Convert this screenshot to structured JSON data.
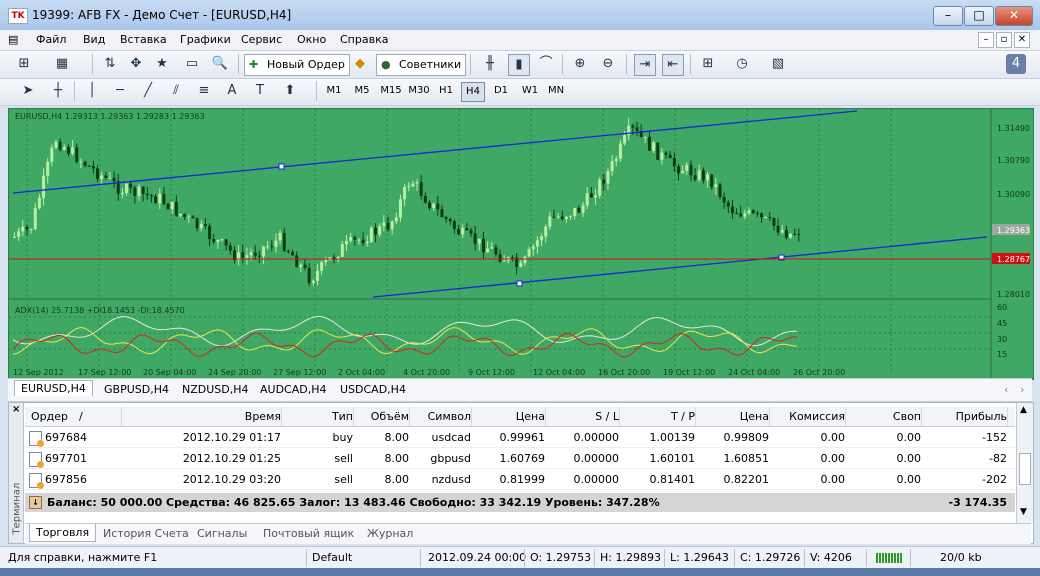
{
  "window": {
    "title": "19399: AFB FX - Демо Счет - [EURUSD,H4]",
    "app_icon_text": "TK",
    "controls": [
      "–",
      "□",
      "✕"
    ]
  },
  "menu": [
    "Файл",
    "Вид",
    "Вставка",
    "Графики",
    "Сервис",
    "Окно",
    "Справка"
  ],
  "toolbar": {
    "new_order_label": "Новый Ордер",
    "advisors_label": "Советники",
    "timeframes": [
      "M1",
      "M5",
      "M15",
      "M30",
      "H1",
      "H4",
      "D1",
      "W1",
      "MN"
    ],
    "active_timeframe": "H4",
    "alert_badge": "4"
  },
  "chart": {
    "symbol_header": "EURUSD,H4  1.29313 1.29363 1.29283 1.29363",
    "indicator_header": "ADX(14) 25.7138 +DI18.1453 -DI:18.4570",
    "price_levels": [
      "1.31490",
      "1.30790",
      "1.30090",
      "1.29363",
      "1.28767",
      "1.28010"
    ],
    "indicator_levels": [
      "60",
      "45",
      "30",
      "15"
    ],
    "time_labels": [
      "12 Sep 2012",
      "17 Sep 12:00",
      "20 Sep 04:00",
      "24 Sep 20:00",
      "27 Sep 12:00",
      "2 Oct 04:00",
      "4 Oct 20:00",
      "9 Oct 12:00",
      "12 Oct 04:00",
      "16 Oct 20:00",
      "19 Oct 12:00",
      "24 Oct 04:00",
      "26 Oct 20:00"
    ],
    "current_price": "1.29363",
    "horizontal_line_price": "1.28767",
    "colors": {
      "background": "#3fa864",
      "bull": "#b8f0a0",
      "bear": "#0b3d14",
      "channel": "#1a24d8",
      "hline": "#d01010"
    }
  },
  "symbol_tabs": [
    "EURUSD,H4",
    "GBPUSD,H4",
    "NZDUSD,H4",
    "AUDCAD,H4",
    "USDCAD,H4"
  ],
  "terminal": {
    "side_label": "Терминал",
    "columns": [
      "Ордер",
      "/",
      "Время",
      "Тип",
      "Объём",
      "Символ",
      "Цена",
      "S / L",
      "T / P",
      "Цена",
      "Комиссия",
      "Своп",
      "Прибыль"
    ],
    "orders": [
      {
        "id": "697684",
        "time": "2012.10.29 01:17",
        "type": "buy",
        "volume": "8.00",
        "symbol": "usdcad",
        "price": "0.99961",
        "sl": "0.00000",
        "tp": "1.00139",
        "cur_price": "0.99809",
        "commission": "0.00",
        "swap": "0.00",
        "profit": "-152"
      },
      {
        "id": "697701",
        "time": "2012.10.29 01:25",
        "type": "sell",
        "volume": "8.00",
        "symbol": "gbpusd",
        "price": "1.60769",
        "sl": "0.00000",
        "tp": "1.60101",
        "cur_price": "1.60851",
        "commission": "0.00",
        "swap": "0.00",
        "profit": "-82"
      },
      {
        "id": "697856",
        "time": "2012.10.29 03:20",
        "type": "sell",
        "volume": "8.00",
        "symbol": "nzdusd",
        "price": "0.81999",
        "sl": "0.00000",
        "tp": "0.81401",
        "cur_price": "0.82201",
        "commission": "0.00",
        "swap": "0.00",
        "profit": "-202"
      }
    ],
    "balance_line": "Баланс: 50 000.00  Средства: 46 825.65  Залог: 13 483.46  Свободно: 33 342.19  Уровень: 347.28%",
    "total_profit": "-3 174.35",
    "tabs": [
      "Торговля",
      "История Счета",
      "Сигналы",
      "Почтовый ящик",
      "Журнал"
    ],
    "active_tab": "Торговля"
  },
  "status": {
    "help": "Для справки, нажмите F1",
    "profile": "Default",
    "datetime": "2012.09.24 00:00",
    "open": "O: 1.29753",
    "high": "H: 1.29893",
    "low": "L: 1.29643",
    "close": "C: 1.29726",
    "volume": "V: 4206",
    "traffic": "20/0 kb"
  }
}
